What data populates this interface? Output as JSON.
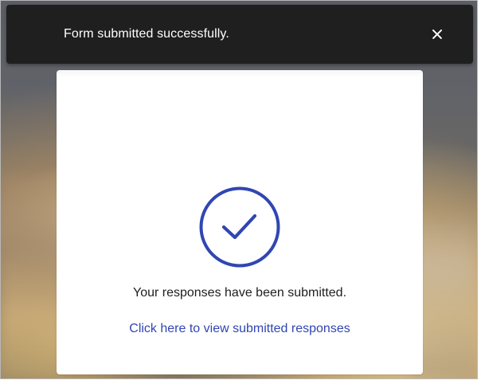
{
  "toast": {
    "message": "Form submitted successfully.",
    "close_icon": "close-icon",
    "background": "#1f1f1f",
    "text_color": "#ffffff"
  },
  "modal": {
    "status_icon": "check-circle-icon",
    "message": "Your responses have been submitted.",
    "link_text": "Click here to view submitted responses",
    "accent_color": "#3046b2"
  }
}
